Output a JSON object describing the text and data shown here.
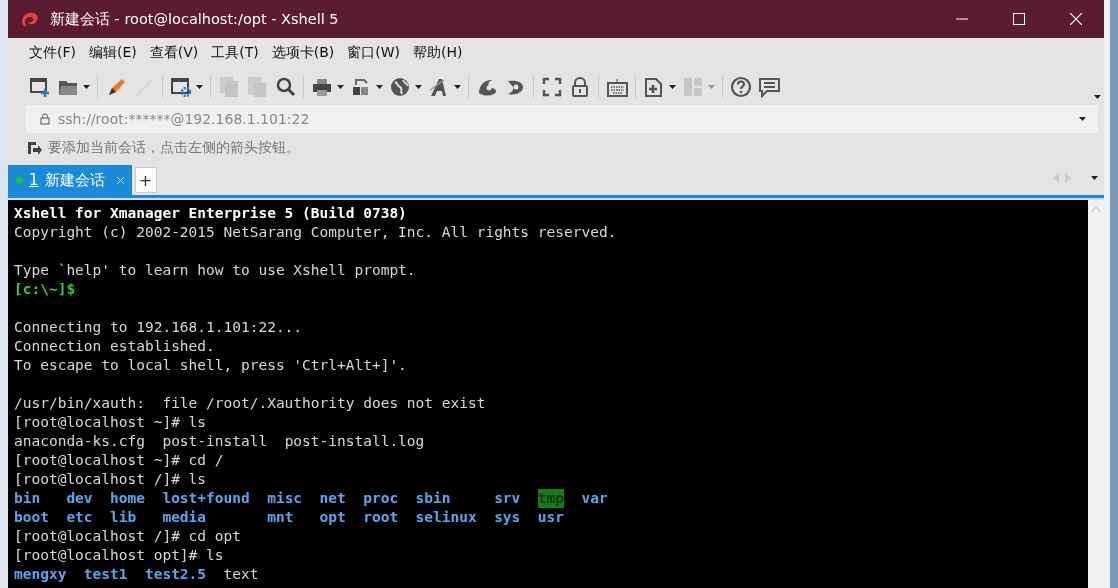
{
  "window": {
    "title": "新建会话 - root@localhost:/opt - Xshell 5"
  },
  "menu": [
    {
      "label": "文件(F)"
    },
    {
      "label": "编辑(E)"
    },
    {
      "label": "查看(V)"
    },
    {
      "label": "工具(T)"
    },
    {
      "label": "选项卡(B)"
    },
    {
      "label": "窗口(W)"
    },
    {
      "label": "帮助(H)"
    }
  ],
  "toolbar": [
    {
      "kind": "button",
      "dropdown": false,
      "disabled": false
    },
    {
      "kind": "button",
      "dropdown": true,
      "disabled": false
    },
    {
      "kind": "separator"
    },
    {
      "kind": "button",
      "dropdown": false,
      "disabled": false
    },
    {
      "kind": "button",
      "dropdown": false,
      "disabled": true
    },
    {
      "kind": "separator"
    },
    {
      "kind": "button",
      "dropdown": true,
      "disabled": false
    },
    {
      "kind": "separator"
    },
    {
      "kind": "button",
      "dropdown": false,
      "disabled": true
    },
    {
      "kind": "button",
      "dropdown": false,
      "disabled": true
    },
    {
      "kind": "button",
      "dropdown": false,
      "disabled": false
    },
    {
      "kind": "separator"
    },
    {
      "kind": "button",
      "dropdown": true,
      "disabled": false
    },
    {
      "kind": "button",
      "dropdown": true,
      "disabled": false
    },
    {
      "kind": "button",
      "dropdown": true,
      "disabled": false
    },
    {
      "kind": "button",
      "dropdown": true,
      "disabled": false
    },
    {
      "kind": "separator"
    },
    {
      "kind": "button",
      "dropdown": false,
      "disabled": false
    },
    {
      "kind": "button",
      "dropdown": false,
      "disabled": false
    },
    {
      "kind": "separator"
    },
    {
      "kind": "button",
      "dropdown": false,
      "disabled": false
    },
    {
      "kind": "button",
      "dropdown": false,
      "disabled": false
    },
    {
      "kind": "separator"
    },
    {
      "kind": "button",
      "dropdown": false,
      "disabled": false
    },
    {
      "kind": "separator"
    },
    {
      "kind": "button",
      "dropdown": true,
      "disabled": false
    },
    {
      "kind": "button",
      "dropdown": true,
      "disabled": true
    },
    {
      "kind": "separator"
    },
    {
      "kind": "button",
      "dropdown": false,
      "disabled": false
    },
    {
      "kind": "button",
      "dropdown": false,
      "disabled": false
    }
  ],
  "address": {
    "value": "ssh://root:******@192.168.1.101:22"
  },
  "hint": "要添加当前会话，点击左侧的箭头按钮。",
  "tabs": [
    {
      "number": "1",
      "label": "新建会话",
      "selected": true,
      "connected": true
    }
  ],
  "new_tab_button": "+",
  "terminal": [
    {
      "kind": "line",
      "segments": [
        {
          "text": "Xshell for Xmanager Enterprise 5 (Build 0738)",
          "kind": "bold"
        }
      ]
    },
    {
      "kind": "line",
      "segments": [
        {
          "text": "Copyright (c) 2002-2015 NetSarang Computer, Inc. All rights reserved.",
          "kind": "plain"
        }
      ]
    },
    {
      "kind": "blank"
    },
    {
      "kind": "line",
      "segments": [
        {
          "text": "Type `help' to learn how to use Xshell prompt.",
          "kind": "plain"
        }
      ]
    },
    {
      "kind": "line",
      "segments": [
        {
          "text": "[c:\\~]$",
          "kind": "prompt"
        }
      ]
    },
    {
      "kind": "blank"
    },
    {
      "kind": "line",
      "segments": [
        {
          "text": "Connecting to 192.168.1.101:22...",
          "kind": "plain"
        }
      ]
    },
    {
      "kind": "line",
      "segments": [
        {
          "text": "Connection established.",
          "kind": "plain"
        }
      ]
    },
    {
      "kind": "line",
      "segments": [
        {
          "text": "To escape to local shell, press 'Ctrl+Alt+]'.",
          "kind": "plain"
        }
      ]
    },
    {
      "kind": "blank"
    },
    {
      "kind": "line",
      "segments": [
        {
          "text": "/usr/bin/xauth:  file /root/.Xauthority does not exist",
          "kind": "plain"
        }
      ]
    },
    {
      "kind": "line",
      "segments": [
        {
          "text": "[root@localhost ~]# ls",
          "kind": "plain"
        }
      ]
    },
    {
      "kind": "listing",
      "rows": [
        [
          {
            "text": "anaconda-ks.cfg",
            "kind": "file"
          },
          {
            "text": "post-install",
            "kind": "file"
          },
          {
            "text": "post-install.log",
            "kind": "file"
          }
        ]
      ]
    },
    {
      "kind": "line",
      "segments": [
        {
          "text": "[root@localhost ~]# cd /",
          "kind": "plain"
        }
      ]
    },
    {
      "kind": "line",
      "segments": [
        {
          "text": "[root@localhost /]# ls",
          "kind": "plain"
        }
      ]
    },
    {
      "kind": "listing",
      "rows": [
        [
          {
            "text": "bin",
            "kind": "dir"
          },
          {
            "text": "dev",
            "kind": "dir"
          },
          {
            "text": "home",
            "kind": "dir"
          },
          {
            "text": "lost+found",
            "kind": "dir"
          },
          {
            "text": "misc",
            "kind": "dir"
          },
          {
            "text": "net",
            "kind": "dir"
          },
          {
            "text": "proc",
            "kind": "dir"
          },
          {
            "text": "sbin",
            "kind": "dir"
          },
          {
            "text": "srv",
            "kind": "dir"
          },
          {
            "text": "tmp",
            "kind": "sticky"
          },
          {
            "text": "var",
            "kind": "dir"
          }
        ],
        [
          {
            "text": "boot",
            "kind": "dir"
          },
          {
            "text": "etc",
            "kind": "dir"
          },
          {
            "text": "lib",
            "kind": "dir"
          },
          {
            "text": "media",
            "kind": "dir"
          },
          {
            "text": "mnt",
            "kind": "dir"
          },
          {
            "text": "opt",
            "kind": "dir"
          },
          {
            "text": "root",
            "kind": "dir"
          },
          {
            "text": "selinux",
            "kind": "dir"
          },
          {
            "text": "sys",
            "kind": "dir"
          },
          {
            "text": "usr",
            "kind": "dir"
          }
        ]
      ]
    },
    {
      "kind": "line",
      "segments": [
        {
          "text": "[root@localhost /]# cd opt",
          "kind": "plain"
        }
      ]
    },
    {
      "kind": "line",
      "segments": [
        {
          "text": "[root@localhost opt]# ls",
          "kind": "plain"
        }
      ]
    },
    {
      "kind": "listing",
      "rows": [
        [
          {
            "text": "mengxy",
            "kind": "dir"
          },
          {
            "text": "test1",
            "kind": "dir"
          },
          {
            "text": "test2.5",
            "kind": "dir"
          },
          {
            "text": "text",
            "kind": "file"
          }
        ]
      ]
    }
  ]
}
